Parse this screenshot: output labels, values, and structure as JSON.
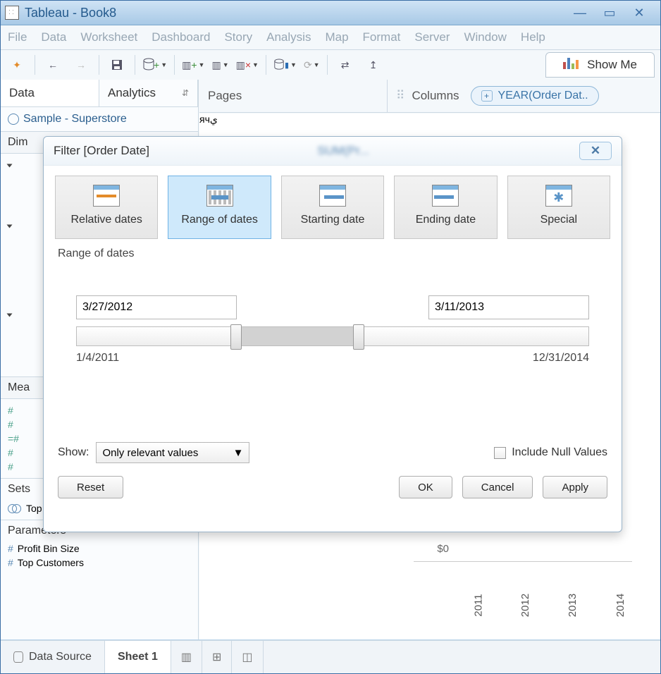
{
  "window": {
    "title": "Tableau - Book8"
  },
  "menu": [
    "File",
    "Data",
    "Worksheet",
    "Dashboard",
    "Story",
    "Analysis",
    "Map",
    "Format",
    "Server",
    "Window",
    "Help"
  ],
  "toolbar": {
    "show_me": "Show Me"
  },
  "sidepane": {
    "tabs": {
      "data": "Data",
      "analytics": "Analytics"
    },
    "datasource": "Sample - Superstore",
    "dimensions_label": "Dim",
    "measures_label": "Mea",
    "sets_label": "Sets",
    "sets_item": "Top Customers by Profit",
    "parameters_label": "Parameters",
    "parameters": [
      "Profit Bin Size",
      "Top Customers"
    ]
  },
  "shelves": {
    "pages": "Pages",
    "columns": "Columns",
    "column_pill": "YEAR(Order Dat.."
  },
  "chart": {
    "y_zero": "$0",
    "x_ticks": [
      "2011",
      "2012",
      "2013",
      "2014"
    ]
  },
  "dialog": {
    "title": "Filter [Order Date]",
    "options": {
      "relative": "Relative dates",
      "range": "Range of dates",
      "starting": "Starting date",
      "ending": "Ending date",
      "special": "Special"
    },
    "section_label": "Range of dates",
    "start_date": "3/27/2012",
    "end_date": "3/11/2013",
    "min_date": "1/4/2011",
    "max_date": "12/31/2014",
    "slider_start_pct": 31,
    "slider_end_pct": 55,
    "show_label": "Show:",
    "show_value": "Only relevant values",
    "include_null": "Include Null Values",
    "buttons": {
      "reset": "Reset",
      "ok": "OK",
      "cancel": "Cancel",
      "apply": "Apply"
    }
  },
  "footer": {
    "datasource": "Data Source",
    "sheet": "Sheet 1"
  }
}
